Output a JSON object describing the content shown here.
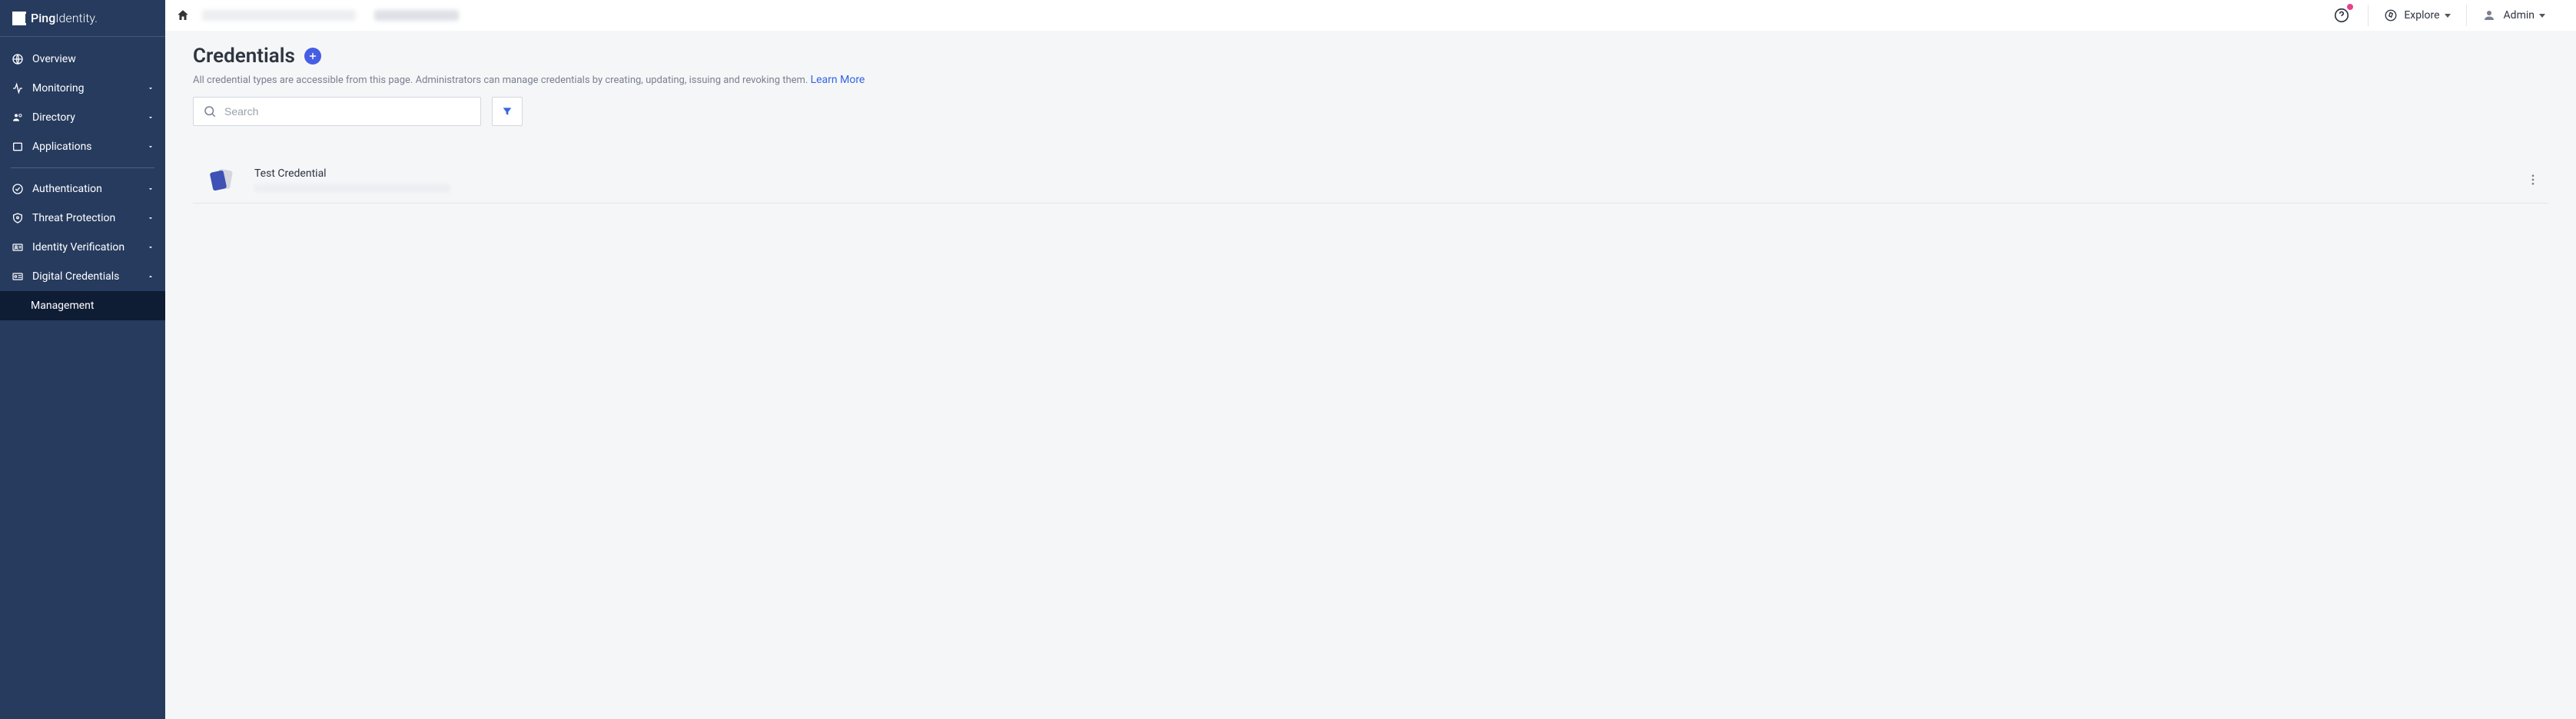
{
  "brand": {
    "part1": "Ping",
    "part2": "Identity."
  },
  "sidebar": {
    "overview": "Overview",
    "monitoring": "Monitoring",
    "directory": "Directory",
    "applications": "Applications",
    "authentication": "Authentication",
    "threat": "Threat Protection",
    "identity_verification": "Identity Verification",
    "digital_credentials": "Digital Credentials",
    "management": "Management"
  },
  "header": {
    "explore": "Explore",
    "admin": "Admin"
  },
  "page": {
    "title": "Credentials",
    "description": "All credential types are accessible from this page. Administrators can manage credentials by creating, updating, issuing and revoking them. ",
    "learn_more": "Learn More",
    "search_placeholder": "Search"
  },
  "items": [
    {
      "title": "Test Credential"
    }
  ]
}
